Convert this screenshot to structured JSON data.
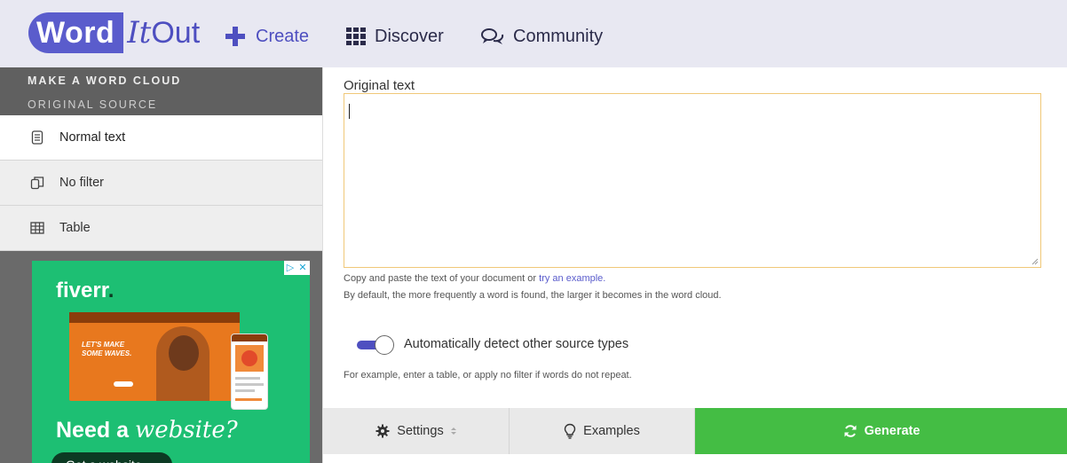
{
  "nav": {
    "logo": {
      "word": "Word",
      "it": "It",
      "out": "Out"
    },
    "create": "Create",
    "discover": "Discover",
    "community": "Community"
  },
  "sidebar": {
    "heading": "MAKE A WORD CLOUD",
    "subheading": "ORIGINAL SOURCE",
    "items": [
      {
        "label": "Normal text",
        "icon": "document-icon",
        "active": true
      },
      {
        "label": "No filter",
        "icon": "copy-icon",
        "active": false
      },
      {
        "label": "Table",
        "icon": "table-icon",
        "active": false
      }
    ]
  },
  "ad": {
    "brand": "fiverr",
    "brand_dot": ".",
    "mock_headline": "LET'S MAKE SOME WAVES.",
    "headline_plain": "Need a ",
    "headline_italic": "website?",
    "cta": "Get a website"
  },
  "editor": {
    "label": "Original text",
    "value": "",
    "help_prefix": "Copy and paste the text of your document or ",
    "help_link": "try an example.",
    "help_line2": "By default, the more frequently a word is found, the larger it becomes in the word cloud.",
    "toggle_label": "Automatically detect other source types",
    "toggle_on": true,
    "note": "For example, enter a table, or apply no filter if words do not repeat."
  },
  "buttons": {
    "settings": "Settings",
    "examples": "Examples",
    "generate": "Generate"
  },
  "colors": {
    "brand": "#5a5ccc",
    "generate": "#44bd44",
    "sidebar": "#6a6a6a",
    "ad": "#1dbf73",
    "textarea_border": "#f0c878"
  }
}
